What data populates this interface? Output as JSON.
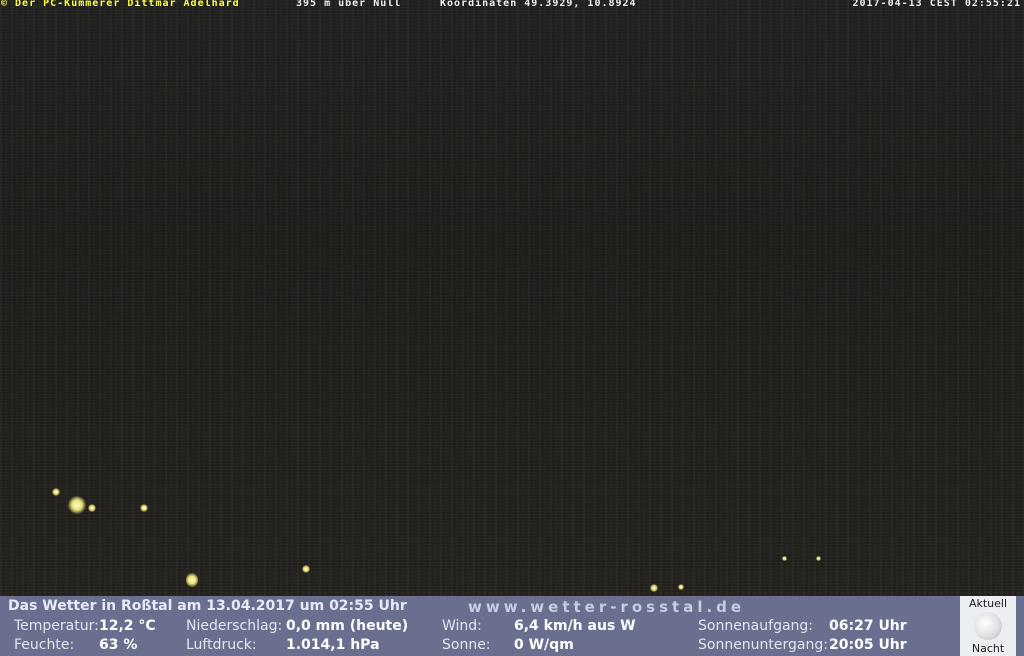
{
  "overlay": {
    "copyright": "© Der PC-Kümmerer Dittmar Adelhard",
    "altitude": "395 m über Null",
    "coordinates": "Koordinaten 49.3929, 10.8924",
    "datetime": "2017-04-13 CEST 02:55:21"
  },
  "weather": {
    "headline": "Das Wetter in Roßtal am 13.04.2017 um 02:55 Uhr",
    "website": "www.wetter-rosstal.de",
    "temperature_label": "Temperatur:",
    "temperature_value": "12,2 °C",
    "humidity_label": "Feuchte:",
    "humidity_value": "63 %",
    "precip_label": "Niederschlag:",
    "precip_value": "0,0 mm (heute)",
    "pressure_label": "Luftdruck:",
    "pressure_value": "1.014,1 hPa",
    "wind_label": "Wind:",
    "wind_value": "6,4 km/h aus W",
    "sun_label": "Sonne:",
    "sun_value": "0 W/qm",
    "sunrise_label": "Sonnenaufgang:",
    "sunrise_value": "06:27 Uhr",
    "sunset_label": "Sonnenuntergang:",
    "sunset_value": "20:05 Uhr",
    "moon_top": "Aktuell",
    "moon_bottom": "Nacht"
  },
  "colors": {
    "bar": "#6a6f8f",
    "overlay_yellow": "#ffff40"
  },
  "icons": {
    "moon": "full-moon-icon"
  }
}
